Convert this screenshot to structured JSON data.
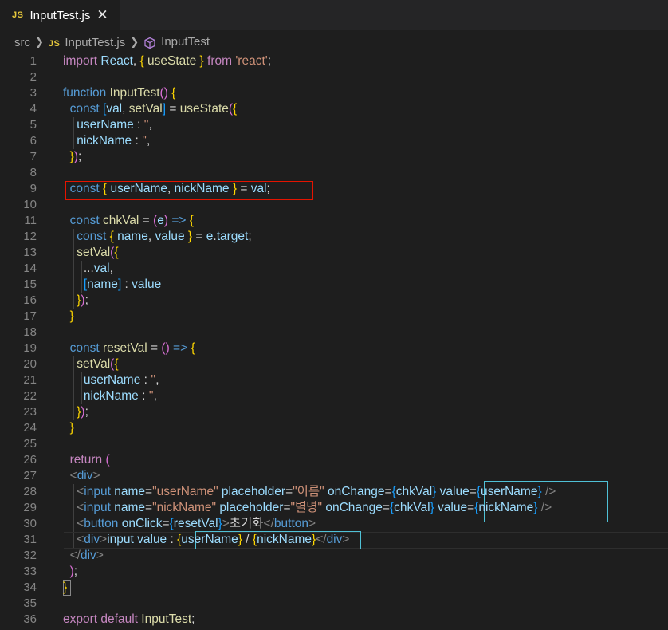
{
  "tab": {
    "icon": "JS",
    "title": "InputTest.js",
    "close_icon": "close-icon"
  },
  "breadcrumb": {
    "folder": "src",
    "file_icon": "JS",
    "file": "InputTest.js",
    "symbol_icon": "symbol-cube-icon",
    "symbol": "InputTest"
  },
  "editor": {
    "language": "javascript",
    "highlight_colors": {
      "box_red": "#e51400",
      "box_cyan": "#4fc1d6"
    },
    "lines": [
      "import React, { useState } from 'react';",
      "",
      "function InputTest() {",
      "  const [val, setVal] = useState({",
      "    userName : '',",
      "    nickName : '',",
      "  });",
      "",
      "  const { userName, nickName } = val;",
      "",
      "  const chkVal = (e) => {",
      "    const { name, value } = e.target;",
      "    setVal({",
      "      ...val,",
      "      [name] : value",
      "    });",
      "  }",
      "",
      "  const resetVal = () => {",
      "    setVal({",
      "      userName : '',",
      "      nickName : '',",
      "    });",
      "  }",
      "",
      "  return (",
      "  <div>",
      "    <input name=\"userName\" placeholder=\"이름\" onChange={chkVal} value={userName} />",
      "    <input name=\"nickName\" placeholder=\"별명\" onChange={chkVal} value={nickName} />",
      "    <button onClick={resetVal}>초기화</button>",
      "    <div>input value : {userName} / {nickName}</div>",
      "  </div>",
      "  );",
      "}",
      "",
      "export default InputTest;"
    ]
  }
}
